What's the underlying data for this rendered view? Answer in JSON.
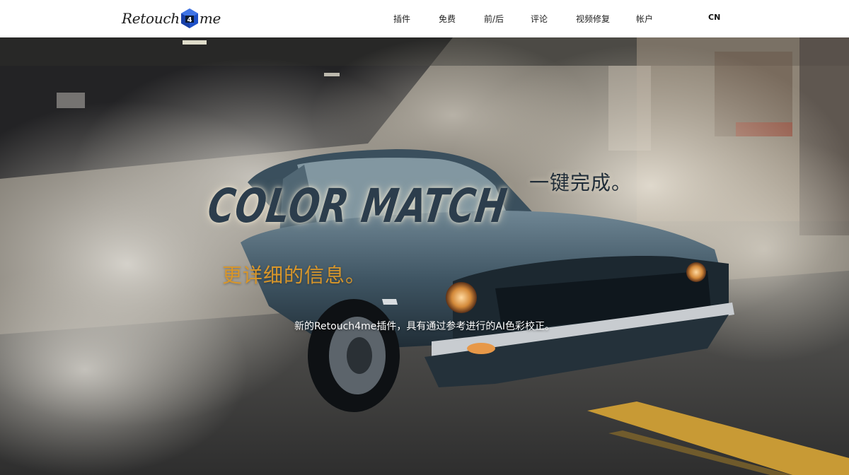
{
  "header": {
    "logo": {
      "text_before": "Retouch",
      "text_after": "me",
      "mark_char": "4"
    },
    "nav": [
      {
        "label": "插件"
      },
      {
        "label": "免费"
      },
      {
        "label": "前/后"
      },
      {
        "label": "评论"
      },
      {
        "label": "视频修复"
      },
      {
        "label": "帐户"
      }
    ],
    "language": "CN"
  },
  "hero": {
    "title": "COLOR MATCH",
    "tagline_top": "一键完成。",
    "tagline_bottom": "更详细的信息。",
    "subtitle": "新的Retouch4me插件，具有通过参考进行的AI色彩校正。",
    "colors": {
      "title": "#2c3d4c",
      "tagline_bottom": "#d8962a",
      "logo_cube": "#1e50c8"
    },
    "background": "blue muscle car drifting in smoke on a city street"
  }
}
